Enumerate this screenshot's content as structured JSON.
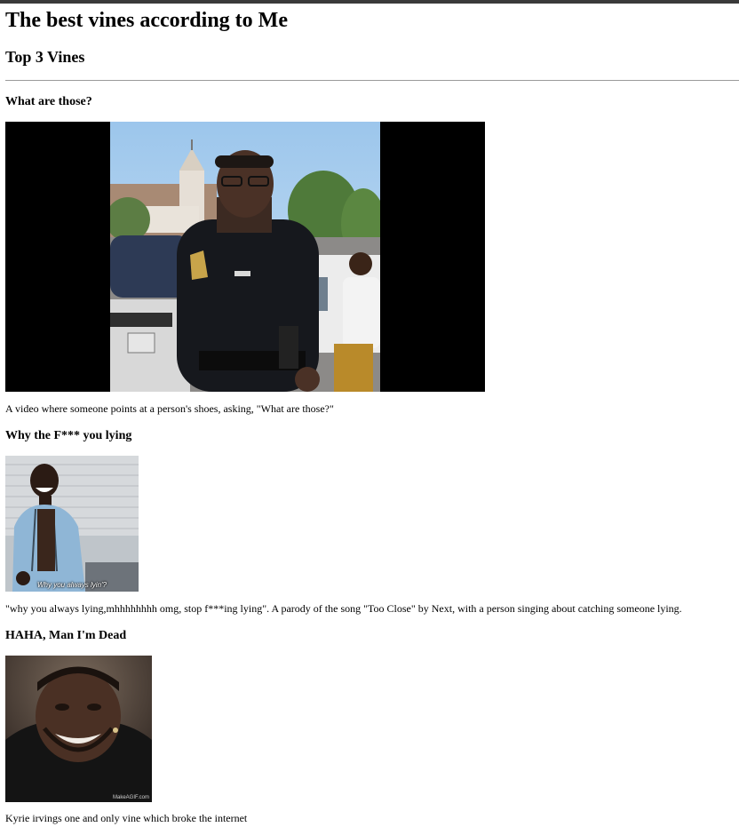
{
  "page": {
    "heading": "The best vines according to Me",
    "subheading": "Top 3 Vines"
  },
  "vines": [
    {
      "title": "What are those?",
      "caption": "A video where someone points at a person's shoes, asking, \"What are those?\""
    },
    {
      "title": "Why the F*** you lying",
      "caption": "\"why you always lying,mhhhhhhhh omg, stop f***ing lying\". A parody of the song \"Too Close\" by Next, with a person singing about catching someone lying.",
      "overlay_text": "Why you always lyin'?"
    },
    {
      "title": "HAHA, Man I'm Dead",
      "caption": "Kyrie irvings one and only vine which broke the internet",
      "watermark": "MakeAGIF.com"
    }
  ]
}
